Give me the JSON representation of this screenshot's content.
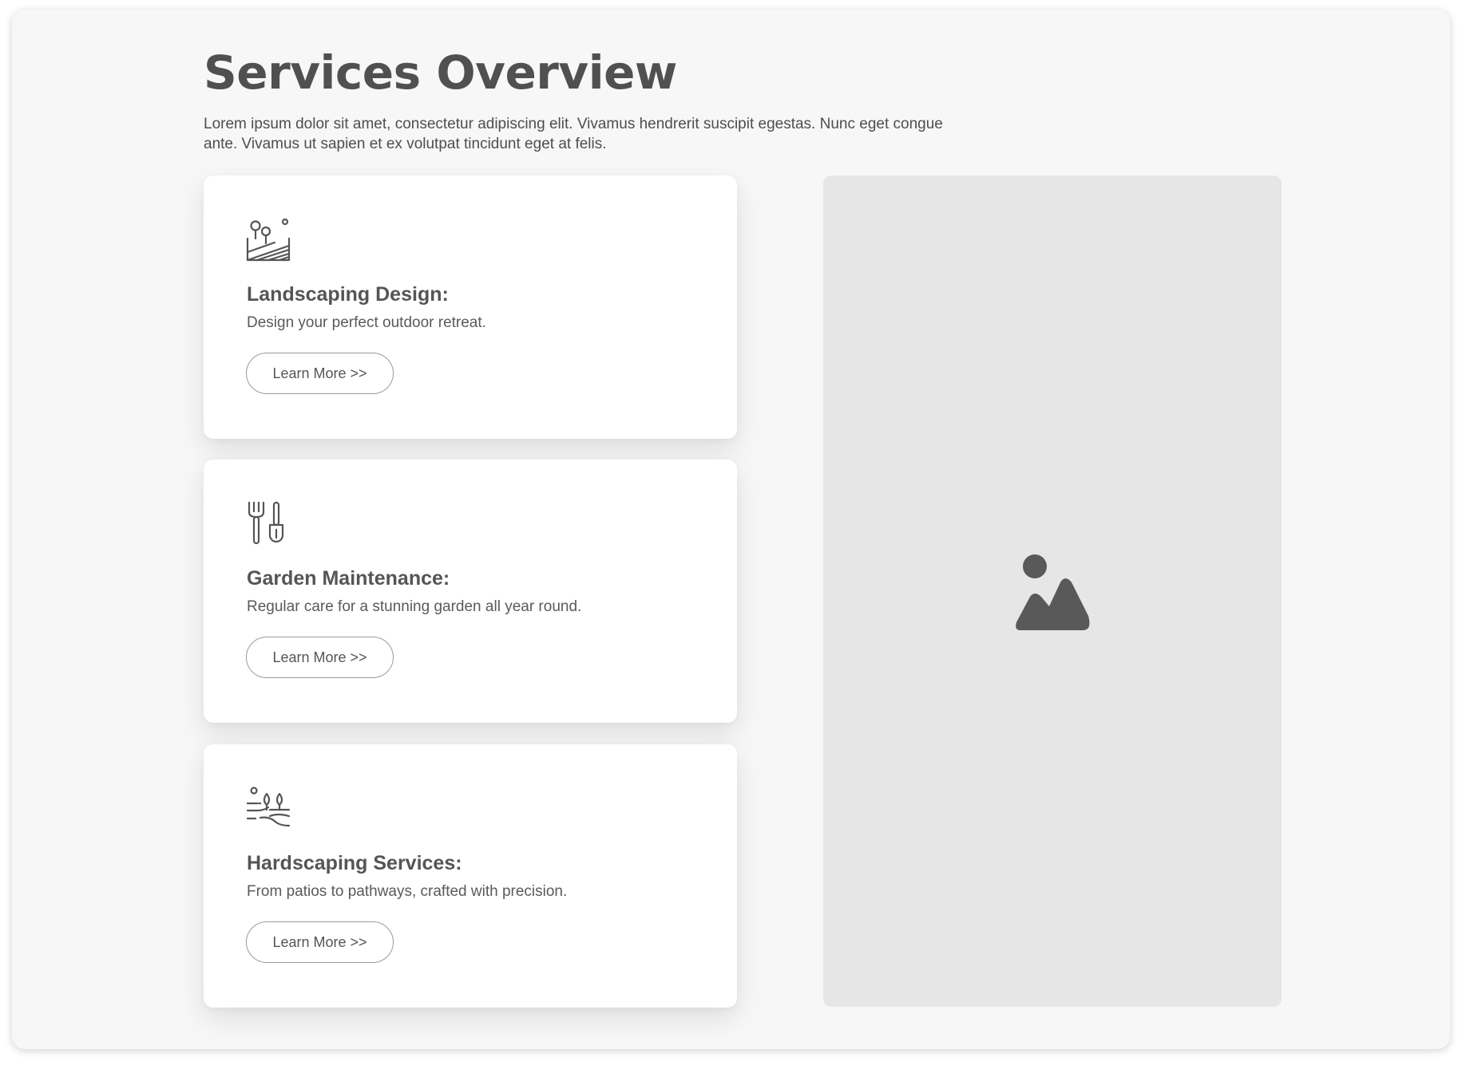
{
  "header": {
    "title": "Services Overview",
    "intro": "Lorem ipsum dolor sit amet, consectetur adipiscing elit. Vivamus hendrerit suscipit egestas. Nunc eget congue ante. Vivamus ut sapien et ex volutpat tincidunt eget at felis."
  },
  "services": [
    {
      "icon": "landscape-hill-icon",
      "title": "Landscaping Design:",
      "description": "Design your perfect outdoor retreat.",
      "button_label": "Learn More >>"
    },
    {
      "icon": "garden-tools-icon",
      "title": "Garden Maintenance:",
      "description": "Regular care for a stunning garden all year round.",
      "button_label": "Learn More >>"
    },
    {
      "icon": "field-plants-icon",
      "title": "Hardscaping Services:",
      "description": "From patios to pathways, crafted with precision.",
      "button_label": "Learn More >>"
    }
  ],
  "media": {
    "icon": "image-placeholder-icon"
  },
  "colors": {
    "background": "#f7f7f7",
    "card": "#ffffff",
    "text": "#555555",
    "placeholder": "#e6e6e6",
    "placeholder_icon": "#595959"
  }
}
